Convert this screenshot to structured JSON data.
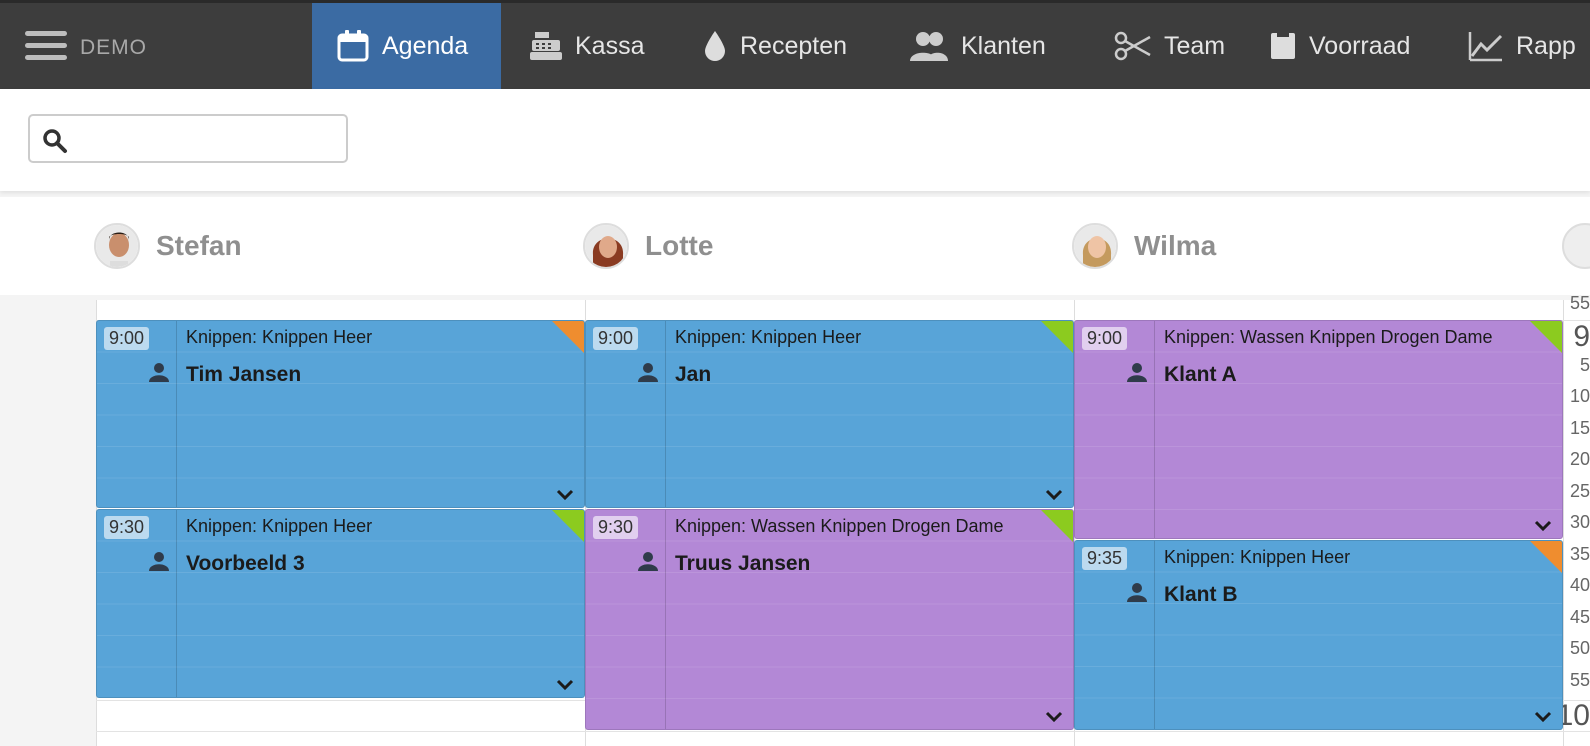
{
  "brand": "DEMO",
  "nav": [
    {
      "label": "Agenda",
      "icon": "calendar-icon",
      "active": true
    },
    {
      "label": "Kassa",
      "icon": "cash-register-icon"
    },
    {
      "label": "Recepten",
      "icon": "drop-icon"
    },
    {
      "label": "Klanten",
      "icon": "users-icon"
    },
    {
      "label": "Team",
      "icon": "scissors-icon"
    },
    {
      "label": "Voorraad",
      "icon": "box-icon"
    },
    {
      "label": "Rapp",
      "icon": "chart-icon"
    }
  ],
  "search": {
    "placeholder": "",
    "value": ""
  },
  "staff": [
    {
      "name": "Stefan"
    },
    {
      "name": "Lotte"
    },
    {
      "name": "Wilma"
    }
  ],
  "time_labels": [
    "55",
    "9",
    "5",
    "10",
    "15",
    "20",
    "25",
    "30",
    "35",
    "40",
    "45",
    "50",
    "55",
    "10"
  ],
  "colors": {
    "blue": "#58a4d8",
    "purple": "#b388d6",
    "orange": "#ef8d2f",
    "green": "#8ccb1f",
    "nav_active": "#3b6ba3"
  },
  "events": [
    {
      "time": "9:00",
      "service": "Knippen:  Knippen Heer",
      "client": "Tim Jansen",
      "color": "blue",
      "corner": "orange"
    },
    {
      "time": "9:30",
      "service": "Knippen:  Knippen Heer",
      "client": "Voorbeeld 3",
      "color": "blue",
      "corner": "green"
    },
    {
      "time": "9:00",
      "service": "Knippen:  Knippen Heer",
      "client": "Jan",
      "color": "blue",
      "corner": "green"
    },
    {
      "time": "9:30",
      "service": "Knippen:  Wassen Knippen Drogen Dame",
      "client": "Truus Jansen",
      "color": "purple",
      "corner": "green"
    },
    {
      "time": "9:00",
      "service": "Knippen:  Wassen Knippen Drogen Dame",
      "client": "Klant A",
      "color": "purple",
      "corner": "green"
    },
    {
      "time": "9:35",
      "service": "Knippen:  Knippen Heer",
      "client": "Klant B",
      "color": "blue",
      "corner": "orange"
    }
  ]
}
